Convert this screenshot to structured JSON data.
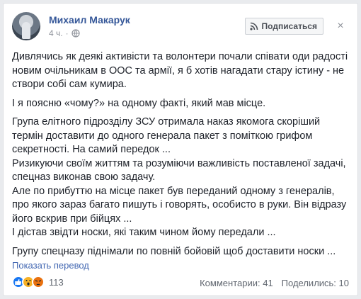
{
  "post": {
    "author": "Михаил Макарук",
    "time": "4 ч.",
    "separator": "·",
    "subscribe_label": "Подписаться",
    "close_glyph": "×",
    "paragraphs": [
      "Дивлячись як деякі активісти та волонтери почали співати оди радості новим очільникам в ООС та армії, я б хотів нагадати стару істину - не створи собі сам кумира.",
      "І я поясню «чому?» на одному факті, який мав місце.",
      "Група елітного підрозділу ЗСУ отримала наказ якомога скоріший термін доставити до одного генерала пакет з поміткою грифом секретності. На самий передок ...",
      "Ризикуючи своїм життям та розуміючи важливість поставленої задачі, спецназ виконав свою задачу.",
      "Але по прибуттю на місце пакет був переданий одному з генералів, про якого зараз багато пишуть і говорять, особисто в руки. Він відразу його вскрив при бійцях ...",
      "І дістав звідти носки, які таким чином йому передали ...",
      "Групу спецназу піднімали по повній бойовій щоб доставити носки ..."
    ],
    "translate_label": "Показать перевод",
    "reactions_count": "113",
    "comments_label": "Комментарии: 41",
    "shares_label": "Поделились: 10"
  },
  "icons": {
    "globe": "globe-icon",
    "feed": "feed-icon",
    "like": "like-reaction-icon",
    "wow": "wow-reaction-icon",
    "angry": "angry-reaction-icon"
  },
  "colors": {
    "link": "#365899",
    "translate_link": "#4267b2",
    "meta": "#90949c"
  }
}
